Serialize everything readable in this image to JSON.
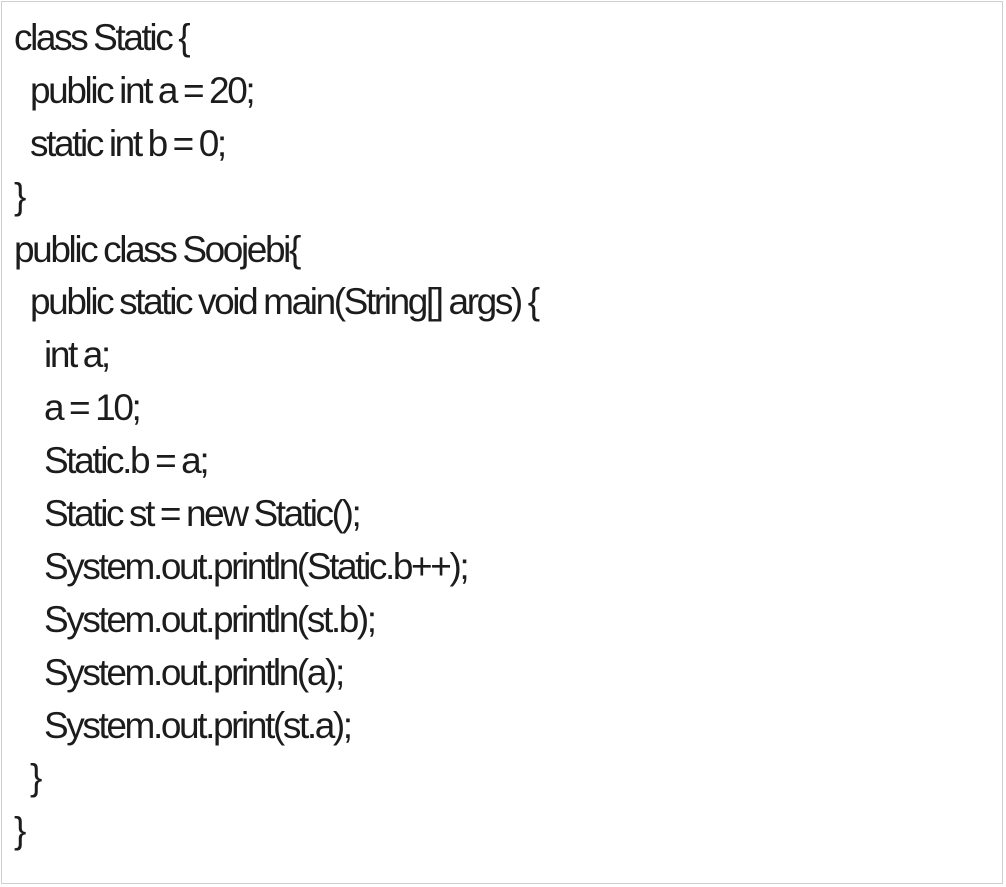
{
  "code": {
    "lines": [
      "class Static {",
      "public int a = 20;",
      "static int b = 0;",
      "}",
      "public class Soojebi{",
      "public static void main(String[] args) {",
      "int a;",
      "a = 10;",
      "Static.b = a;",
      "Static st = new Static();",
      "System.out.println(Static.b++);",
      "System.out.println(st.b);",
      "System.out.println(a);",
      "System.out.print(st.a);",
      "}",
      "}"
    ]
  }
}
